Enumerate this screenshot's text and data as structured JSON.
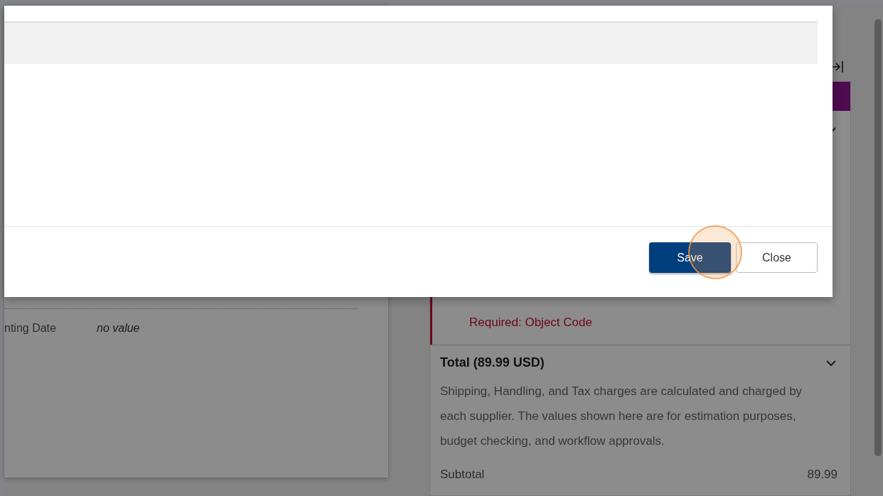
{
  "modal": {
    "buttons": [
      {
        "label": "Save",
        "kind": "primary"
      },
      {
        "label": "Close",
        "kind": "secondary"
      }
    ]
  },
  "details": {
    "fields": [
      {
        "label": "nting Date",
        "value": "no value"
      }
    ]
  },
  "summary": {
    "errors": [
      "Required: Object Code"
    ],
    "total": {
      "title": "Total (89.99 USD)",
      "expanded": true,
      "note": "Shipping, Handling, and Tax charges are calculated and charged by each supplier. The values shown here are for estimation purposes, budget checking, and workflow approvals.",
      "rows": [
        {
          "label": "Subtotal",
          "value": "89.99"
        }
      ]
    }
  }
}
